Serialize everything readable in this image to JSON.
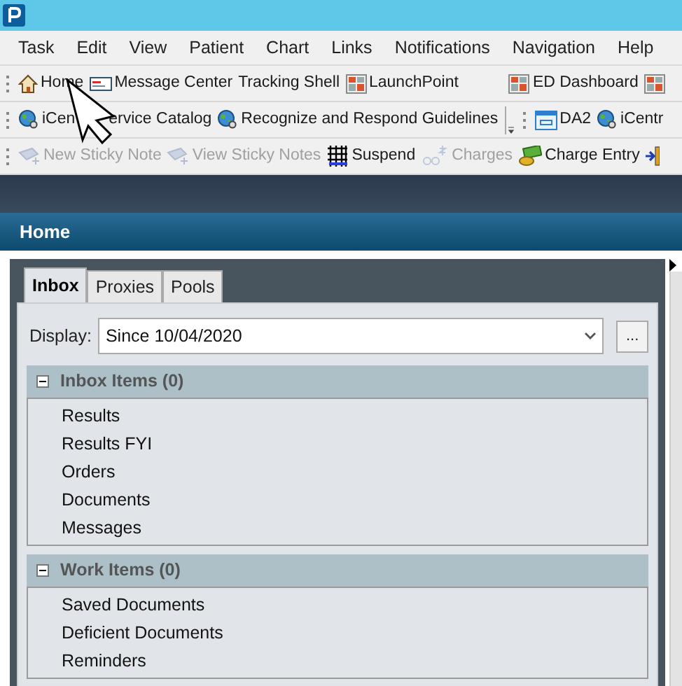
{
  "menu": [
    "Task",
    "Edit",
    "View",
    "Patient",
    "Chart",
    "Links",
    "Notifications",
    "Navigation",
    "Help"
  ],
  "toolbars": [
    [
      {
        "kind": "house",
        "label": "Home",
        "disabled": false
      },
      {
        "kind": "card",
        "label": "Message Center",
        "disabled": false
      },
      {
        "kind": "text",
        "label": "Tracking Shell",
        "disabled": false
      },
      {
        "kind": "grid",
        "label": "LaunchPoint",
        "disabled": false
      },
      {
        "kind": "spacer"
      },
      {
        "kind": "grid",
        "label": "ED Dashboard",
        "disabled": false
      },
      {
        "kind": "grid",
        "disabled": false
      }
    ],
    [
      {
        "kind": "globe",
        "label": "iCen",
        "label_after": "ervice Catalog",
        "disabled": false
      },
      {
        "kind": "globe",
        "label": "Recognize and Respond Guidelines",
        "disabled": false
      },
      {
        "kind": "overflow"
      },
      {
        "kind": "window",
        "label": "DA2",
        "disabled": false
      },
      {
        "kind": "globe",
        "label": "iCentr",
        "disabled": false
      }
    ],
    [
      {
        "kind": "note",
        "label": "New Sticky Note",
        "disabled": true
      },
      {
        "kind": "note",
        "label": "View Sticky Notes",
        "disabled": true
      },
      {
        "kind": "fence",
        "label": "Suspend",
        "disabled": false
      },
      {
        "kind": "dollar",
        "label": "Charges",
        "disabled": true
      },
      {
        "kind": "money",
        "label": "Charge Entry",
        "disabled": false
      },
      {
        "kind": "exit",
        "disabled": false
      }
    ]
  ],
  "page_title": "Home",
  "tabs": [
    {
      "label": "Inbox",
      "selected": true
    },
    {
      "label": "Proxies",
      "selected": false
    },
    {
      "label": "Pools",
      "selected": false
    }
  ],
  "display": {
    "label": "Display:",
    "value": "Since 10/04/2020",
    "more_button": "..."
  },
  "sections": [
    {
      "title": "Inbox Items (0)",
      "expanded": true,
      "items": [
        "Results",
        "Results FYI",
        "Orders",
        "Documents",
        "Messages"
      ]
    },
    {
      "title": "Work Items (0)",
      "expanded": true,
      "items": [
        "Saved Documents",
        "Deficient Documents",
        "Reminders"
      ]
    }
  ]
}
